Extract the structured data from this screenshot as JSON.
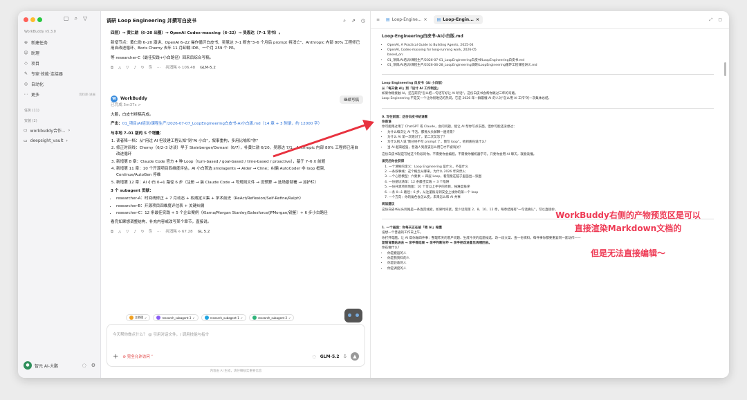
{
  "sidebar": {
    "brand": "WorkBuddy v5.3.0",
    "nav": [
      {
        "icon": "⊕",
        "label": "新建任务"
      },
      {
        "icon": "☺",
        "label": "助理"
      },
      {
        "icon": "◇",
        "label": "项目"
      },
      {
        "icon": "✎",
        "label": "专家·技能·连接器"
      },
      {
        "icon": "◎",
        "label": "自动化"
      },
      {
        "icon": "⋯",
        "label": "更多",
        "badge": "资料库·进展"
      }
    ],
    "tasks_label": "任务 (11)",
    "projects_label": "安装 (2)",
    "folders": [
      "workbuddy合作...",
      "deepsight_vault"
    ],
    "user": "智元 AI-大鹏"
  },
  "chat": {
    "title": "调研 Loop Engineering 并撰写白皮书",
    "line1": "四层）→ 黄仁勋（6–20 出圈）→ OpenAI Codex-maxxing（6–22）→ 吴恩达（7–1 背书）。",
    "line2": "新增节点：黄仁勋 6–20 演讲、OpenAI 6–22 操作循环白皮书、吴恩达 7–1 断言\"3–6 个月后 prompt 将消亡\"、Anthropic 内部 80% 工程师已用自改进循环、Boris Cherny 去年 11 月卸载 IDE、一个月 259 个 PR。",
    "line3": "等 researcher-C（最佳实践+小白路径）回来后综合写稿。",
    "meta1": "共消耗 ⟡ 106.48",
    "model": "GLM-5.2",
    "chip": "继续写稿",
    "wb_name": "WorkBuddy",
    "wb_time": "已完成 5m37s >",
    "done": "大鹏，白皮书终稿完成。",
    "product_label": "产出：",
    "product": "01_项目/AI培训/课程生产/2026-07-07_LoopEngineering白皮书-AI小白版.md（14 章 + 3 附录，约 12000 字）",
    "compare": "与本地 7–01 版的 5 个增量：",
    "increments": [
      "读者降一档：从\"用过 AI 但没建工程认知\"到\"AI 小白\"，叙事重构，多用比喻和\"你\"",
      "修正时间线：Cherny（6/2–3 访谈）早于 Steinberger/Osmani（6/7），补黄仁勋 6/20、吴恩达 7/1、Anthropic 内部 80% 工程师已用自改进循环",
      "新增第 8 章：Claude Code 官方 4 种 Loop（turn-based / goal-based / time-based / proactive），基于 7–6 X 前题",
      "新增第 11 章：10 个开源项目四维度评估，AI 小白首选 smolagents → Aider → Cline；纠偏 AutoCoder 非 loop 框架、Continue/AutoGen 停维",
      "新增第 12 章：AI 小白 0→1 路径 6 步（注册 → 装 Claude Code → 写规则文件 → 设预算 → 选场景部署 → 加护栏）"
    ],
    "subagents_title": "3 个 subagent 贡献：",
    "subagents": [
      "researcher-A：时间线修正 + 7 月动态 + 权威定义集 + 学术前史（ReAct/Reflexion/Self-Refine/Ralph）",
      "researcher-B：开源项目四维度评估表 + 关键纠偏",
      "researcher-C：12 条最佳实践 + 5 个企业案例（Klarna/Morgan Stanley/Salesforce/JPMorgan/锐鉴）+ 6 步小白路径"
    ],
    "closing": "看完如果想调整结构、补充内容或改写某个章节，直接说。",
    "meta2": "共消耗 ⟡ 67.28",
    "model2": "GL 5.2",
    "agents": [
      {
        "name": "主助理",
        "color": "#f0a020"
      },
      {
        "name": "research_subagent-3",
        "color": "#8a5cf5"
      },
      {
        "name": "research_subagent-1",
        "color": "#1fa3e0"
      },
      {
        "name": "research_subagent-2",
        "color": "#2fb37a"
      }
    ],
    "input_placeholder": "今天帮你做点什么？ @ 引用对话文件，/ 调用技能与指令",
    "access": "完全允许访问",
    "footnote": "内容由 AI 生成，请仔细核实重要信息"
  },
  "preview": {
    "tabs": [
      "Loop-Engine...",
      "Loop-Engin..."
    ],
    "filename": "Loop-Engineering白皮书-AI小白版.md",
    "refs": [
      "OpenAI, A Practical Guide to Building Agents, 2025-04",
      "OpenAI, Codex-maxxing for long-running work, 2026-05",
      "based_on:",
      "01_项目/AI培训/课程生产/2026-07-01_LoopEngineering白皮书/LoopEngineering白皮书.md",
      "01_项目/AI培训/课程生产/2026-06-28_LoopEngineering调研/LoopEngineering循环工程课程讲义.md"
    ],
    "title": "Loop Engineering 白皮书（AI 小白版）",
    "subtitle": "从「每天做 AI」到「设计 AI 工作制度」",
    "intro": [
      "如果你刚接触 AI，还在研究\"怎么把一句话写好让 AI 听话\"，这份白皮书会帮你跳过三年的弯路。",
      "Loop Engineering 不是又一个让你很难记的热词，它是 2026 年一群最懂 AI 的人对\"怎么用 AI 工作\"的一次集体总结。"
    ],
    "s0": "0. 写在前面：这份白皮书给谁看",
    "s0sub": "你是谁",
    "s0p": "你可能用过用了 ChatGPT 或 Claude，会问问题，能让 AI 帮你写点东西。但你可能还没想过：",
    "q": [
      "为什么每次让 AI 干活，都要从头解释一遍背景？",
      "为什么 AI 第一次跑对了，第二次又忘了？",
      "为什么别人说\"我已经不写 prompt 了，我写 loop\"，他到底在说什么？",
      "当 AI 越来越强，普通人到底该怎么用它才不被淘汰？"
    ],
    "s0p2": "这份白皮书就是写给这个阶段的你。不需要你会编程，不需要你懂机器学习。只要你会用 AI 聊天，就能读懂。",
    "readfrom": "读完后你会获得",
    "gains": [
      "一个清晰的定义：Loop Engineering 是什么，不是什么",
      "一条叙事线：这个概念从哪来，为什么 2026 年突然火",
      "一个心智模型：六要素 + 四层 Loop，看完能在脑子里画出一张图",
      "一份避坑清单：12 条最佳实践 + 3 个陷阱",
      "一份开源项目地图：10 个可以上手学的项目，按难度排序",
      "一条 0→1 路径：6 步，从注册账号到安全上线你的第一个 loop",
      "一个方向：你的角色会怎么变，未来怎么和 AI 共事"
    ],
    "readhint": "阅读建议",
    "readhintp": "这份白皮书从头到尾是一条连贯线索。如果时间紧，至少读完第 2、8、10、12 章，每章结尾有\"一句话确认\"，可以直接抄。",
    "s1": "1. 一个画面：你每天正在被「喂 AI」拖慢",
    "s1p": "设想一个普通的工作日上午。",
    "s1p2": "你打开电脑，让 AI 帮你做四件事：整理昨天的客户问题、生成今天的选题候选、改一段文案、查一份资料。每件事你都要重复同一套动作——",
    "s1p3": "复制背景贴进去 → 亲手等结果 → 亲手判断好坏 → 亲手把改进意见再喂回去。",
    "s1q": "你在做什么？",
    "roles": [
      "你是搬运的人",
      "你是我资料的人",
      "你是验收的人",
      "你是调度的人"
    ]
  },
  "annotation": {
    "line1": "WorkBuddy右侧的产物预览区是可以",
    "line2": "直接渲染Markdown文档的",
    "line3": "但是无法直接编辑～"
  }
}
